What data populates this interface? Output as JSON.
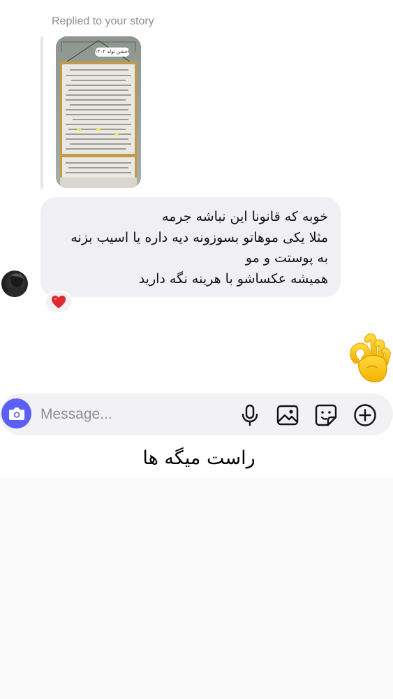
{
  "story_reply": {
    "label": "Replied to your story",
    "thumbnail_caption": "جشن تولد ۱۴۰۲😄"
  },
  "message": {
    "lines": [
      "خوبه که قانونا این نباشه جرمه",
      "مثلا یکی موهاتو بسوزونه دیه داره یا اسیب بزنه",
      "به پوستت و مو",
      "همیشه عکساشو با هرینه نگه دارید"
    ],
    "reaction": "❤️"
  },
  "sent_emoji": "👌",
  "composer": {
    "placeholder": "Message...",
    "camera_icon": "camera-icon",
    "icons": [
      "microphone-icon",
      "gallery-icon",
      "sticker-icon",
      "add-icon"
    ],
    "accent_color": "#5b5ff5"
  },
  "overlay_caption": "راست میگه ها"
}
